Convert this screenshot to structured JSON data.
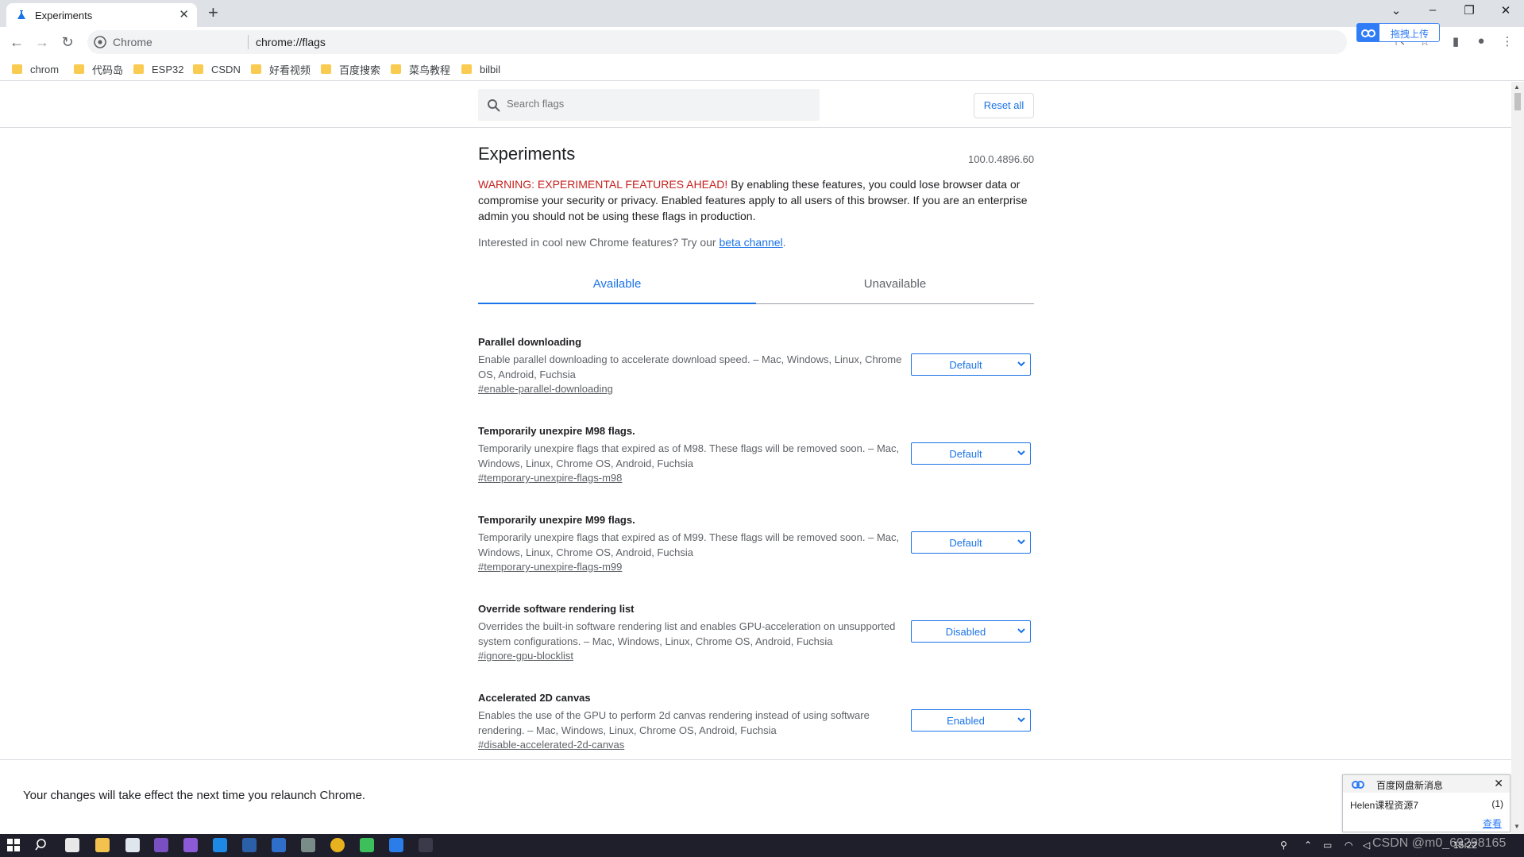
{
  "browser": {
    "tab_title": "Experiments",
    "omnibox_site": "Chrome",
    "omnibox_url": "chrome://flags",
    "upload_button": "拖拽上传"
  },
  "bookmarks": [
    {
      "label": "chrom"
    },
    {
      "label": "代码岛"
    },
    {
      "label": "ESP32"
    },
    {
      "label": "CSDN"
    },
    {
      "label": "好看视频"
    },
    {
      "label": "百度搜索"
    },
    {
      "label": "菜鸟教程"
    },
    {
      "label": "bilbil"
    }
  ],
  "flags_page": {
    "search_placeholder": "Search flags",
    "reset_all": "Reset all",
    "title": "Experiments",
    "version": "100.0.4896.60",
    "warning_red": "WARNING: EXPERIMENTAL FEATURES AHEAD!",
    "warning_rest": "By enabling these features, you could lose browser data or compromise your security or privacy. Enabled features apply to all users of this browser. If you are an enterprise admin you should not be using these flags in production.",
    "promo_text": "Interested in cool new Chrome features? Try our ",
    "promo_link": "beta channel",
    "promo_end": ".",
    "tab_available": "Available",
    "tab_unavailable": "Unavailable",
    "relaunch_message": "Your changes will take effect the next time you relaunch Chrome."
  },
  "flags": [
    {
      "title": "Parallel downloading",
      "description": "Enable parallel downloading to accelerate download speed. – Mac, Windows, Linux, Chrome OS, Android, Fuchsia",
      "link": "#enable-parallel-downloading",
      "value": "Default"
    },
    {
      "title": "Temporarily unexpire M98 flags.",
      "description": "Temporarily unexpire flags that expired as of M98. These flags will be removed soon. – Mac, Windows, Linux, Chrome OS, Android, Fuchsia",
      "link": "#temporary-unexpire-flags-m98",
      "value": "Default"
    },
    {
      "title": "Temporarily unexpire M99 flags.",
      "description": "Temporarily unexpire flags that expired as of M99. These flags will be removed soon. – Mac, Windows, Linux, Chrome OS, Android, Fuchsia",
      "link": "#temporary-unexpire-flags-m99",
      "value": "Default"
    },
    {
      "title": "Override software rendering list",
      "description": "Overrides the built-in software rendering list and enables GPU-acceleration on unsupported system configurations. – Mac, Windows, Linux, Chrome OS, Android, Fuchsia",
      "link": "#ignore-gpu-blocklist",
      "value": "Disabled"
    },
    {
      "title": "Accelerated 2D canvas",
      "description": "Enables the use of the GPU to perform 2d canvas rendering instead of using software rendering. – Mac, Windows, Linux, Chrome OS, Android, Fuchsia",
      "link": "#disable-accelerated-2d-canvas",
      "value": "Enabled"
    }
  ],
  "notification": {
    "title": "百度网盘新消息",
    "message": "Helen课程资源7",
    "count": "(1)",
    "view": "查看"
  },
  "taskbar": {
    "watermark": "CSDN @m0_69298165",
    "clock": "15:22"
  },
  "colors": {
    "accent": "#1a73e8",
    "warning": "#c5221f",
    "folder": "#f9cb51",
    "taskbar": "#1f1f2b"
  }
}
